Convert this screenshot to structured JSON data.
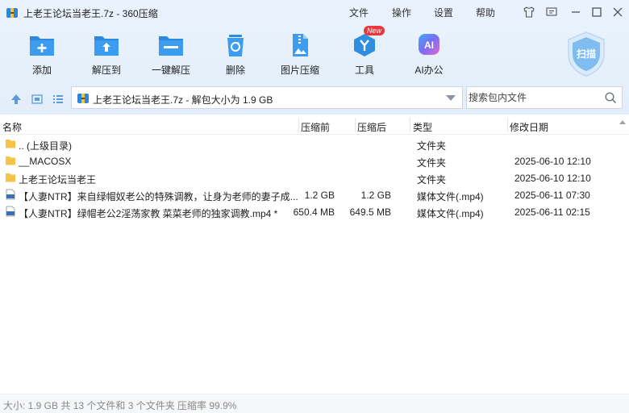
{
  "window": {
    "title": "上老王论坛当老王.7z - 360压缩",
    "menu": [
      "文件",
      "操作",
      "设置",
      "帮助"
    ]
  },
  "toolbar": {
    "items": [
      {
        "label": "添加",
        "icon": "add-folder-icon"
      },
      {
        "label": "解压到",
        "icon": "extract-to-icon"
      },
      {
        "label": "一键解压",
        "icon": "one-click-extract-icon"
      },
      {
        "label": "删除",
        "icon": "recycle-bin-icon"
      },
      {
        "label": "图片压缩",
        "icon": "image-compress-icon"
      },
      {
        "label": "工具",
        "icon": "tools-icon"
      },
      {
        "label": "AI办公",
        "icon": "ai-office-icon"
      }
    ],
    "new_badge": "New",
    "scan_label": "扫描"
  },
  "navigation": {
    "path": "上老王论坛当老王.7z - 解包大小为 1.9 GB",
    "search_placeholder": "搜索包内文件"
  },
  "columns": {
    "name": "名称",
    "packed": "压缩前",
    "original": "压缩后",
    "type": "类型",
    "modified": "修改日期"
  },
  "files": [
    {
      "name": ".. (上级目录)",
      "packed": "",
      "original": "",
      "type": "文件夹",
      "modified": "",
      "icon": "folder-icon"
    },
    {
      "name": "__MACOSX",
      "packed": "",
      "original": "",
      "type": "文件夹",
      "modified": "2025-06-10 12:10",
      "icon": "folder-icon"
    },
    {
      "name": "上老王论坛当老王",
      "packed": "",
      "original": "",
      "type": "文件夹",
      "modified": "2025-06-10 12:10",
      "icon": "folder-icon"
    },
    {
      "name": "【人妻NTR】来自绿帽奴老公的特殊调教，让身为老师的妻子成...",
      "packed": "1.2 GB",
      "original": "1.2 GB",
      "type": "媒体文件(.mp4)",
      "modified": "2025-06-11 07:30",
      "icon": "mp4-file-icon"
    },
    {
      "name": "【人妻NTR】绿帽老公2淫荡家教 菜菜老师的独家调教.mp4 *",
      "packed": "650.4 MB",
      "original": "649.5 MB",
      "type": "媒体文件(.mp4)",
      "modified": "2025-06-11 02:15",
      "icon": "mp4-file-icon"
    }
  ],
  "status": {
    "text": "大小: 1.9 GB 共 13 个文件和 3 个文件夹 压缩率 99.9%"
  },
  "colors": {
    "accent": "#2f8ee0",
    "toolbar_bg": "#e6f0fb",
    "folder": "#f5c24a"
  }
}
